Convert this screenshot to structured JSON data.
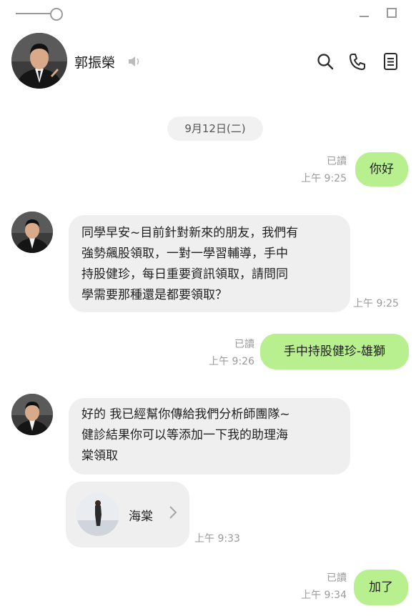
{
  "header": {
    "name": "郭振榮"
  },
  "date_separator": "9月12日(二)",
  "messages": {
    "m1": {
      "text": "你好",
      "read": "已讀",
      "time": "上午 9:25"
    },
    "m2": {
      "text": "同學早安~目前針對新來的朋友，我們有\n強勢飆股領取，一對一學習輔導，手中\n持股健珍，每日重要資訊領取，請問同\n學需要那種還是都要領取？",
      "time": "上午 9:25"
    },
    "m3": {
      "text": "手中持股健珍-雄獅",
      "read": "已讀",
      "time": "上午 9:26"
    },
    "m4": {
      "text": "好的 我已經幫你傳給我們分析師團隊~\n健診結果你可以等添加一下我的助理海\n棠領取"
    },
    "m5": {
      "contact_name": "海棠",
      "time": "上午 9:33"
    },
    "m6": {
      "text": "加了",
      "read": "已讀",
      "time": "上午 9:34"
    }
  },
  "icons": [
    "pin-slider-icon",
    "minimize-icon",
    "maximize-icon",
    "speaker-icon",
    "search-icon",
    "phone-icon",
    "notes-icon",
    "chevron-right-icon"
  ],
  "colors": {
    "outgoing_bubble": "#b9f08f",
    "incoming_bubble": "#efefef",
    "background": "#ffffff"
  }
}
